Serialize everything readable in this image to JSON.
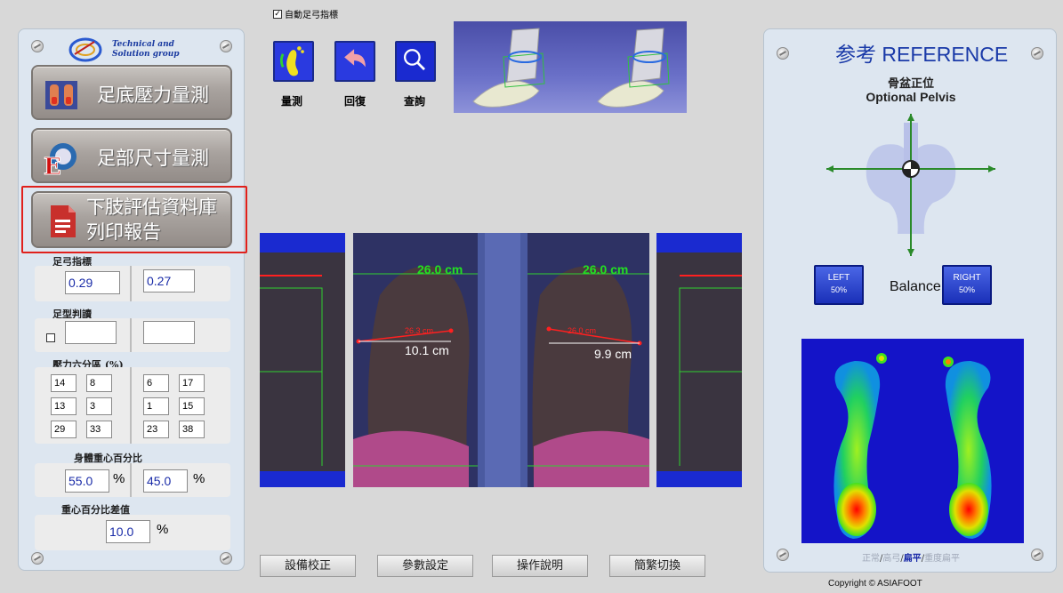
{
  "left_panel": {
    "logo": {
      "line1": "Technical and",
      "line2": "Solution group"
    },
    "nav": [
      {
        "label": "足底壓力量測"
      },
      {
        "label": "足部尺寸量測"
      },
      {
        "label_line1": "下肢評估資料庫",
        "label_line2": "列印報告"
      }
    ],
    "arch_index": {
      "label": "足弓指標",
      "left": "0.29",
      "right": "0.27"
    },
    "foot_type": {
      "label": "足型判讀",
      "left": "",
      "right": ""
    },
    "pressure_zones": {
      "label": "壓力六分區 (%)",
      "left": [
        [
          "14",
          "8"
        ],
        [
          "13",
          "3"
        ],
        [
          "29",
          "33"
        ]
      ],
      "right": [
        [
          "6",
          "17"
        ],
        [
          "1",
          "15"
        ],
        [
          "23",
          "38"
        ]
      ]
    },
    "center_of_gravity": {
      "label": "身體重心百分比",
      "left": "55.0",
      "right": "45.0",
      "unit": "%"
    },
    "cog_difference": {
      "label": "重心百分比差值",
      "value": "10.0",
      "unit": "%"
    }
  },
  "toolbar": {
    "auto_arch_checkbox_label": "自動足弓指標",
    "auto_arch_checked": true,
    "buttons": [
      {
        "label": "量測",
        "icon": "footprint-icon",
        "color": "#2a3ae0"
      },
      {
        "label": "回復",
        "icon": "undo-arrow-icon",
        "color": "#2a3ae0"
      },
      {
        "label": "查詢",
        "icon": "search-icon",
        "color": "#1a2ad0"
      }
    ]
  },
  "scan": {
    "left_length": "26.0 cm",
    "right_length": "26.0 cm",
    "left_width": "10.1 cm",
    "right_width": "9.9 cm",
    "left_red_label": "26.3 cm",
    "right_red_label": "26.0 cm"
  },
  "bottom_buttons": [
    "設備校正",
    "參數設定",
    "操作說明",
    "簡繁切換"
  ],
  "right_panel": {
    "title": "参考 REFERENCE",
    "pelvis_title_cn": "骨盆正位",
    "pelvis_title_en": "Optional Pelvis",
    "left_button": {
      "label": "LEFT",
      "value": "50%"
    },
    "balance_label": "Balance",
    "right_button": {
      "label": "RIGHT",
      "value": "50%"
    },
    "foot_types": [
      "正常",
      "高弓",
      "扁平",
      "重度扁平"
    ],
    "foot_type_active": "扁平"
  },
  "footer": {
    "copyright": "Copyright © ASIAFOOT"
  },
  "colors": {
    "accent_blue": "#1a3aa8",
    "highlight_red": "#e0201c",
    "scan_green": "#22e022"
  }
}
